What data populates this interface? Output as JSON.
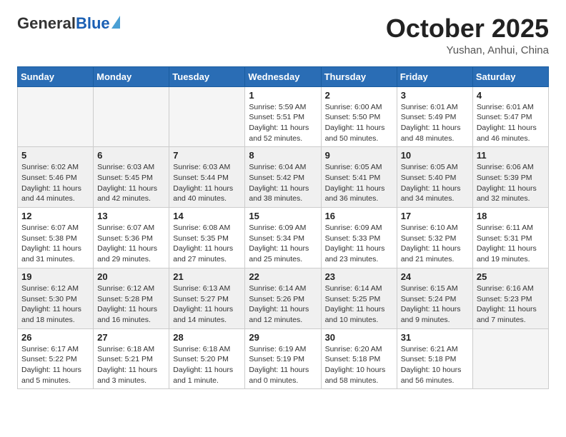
{
  "header": {
    "logo_general": "General",
    "logo_blue": "Blue",
    "month_title": "October 2025",
    "location": "Yushan, Anhui, China"
  },
  "weekdays": [
    "Sunday",
    "Monday",
    "Tuesday",
    "Wednesday",
    "Thursday",
    "Friday",
    "Saturday"
  ],
  "weeks": [
    [
      {
        "day": "",
        "info": ""
      },
      {
        "day": "",
        "info": ""
      },
      {
        "day": "",
        "info": ""
      },
      {
        "day": "1",
        "info": "Sunrise: 5:59 AM\nSunset: 5:51 PM\nDaylight: 11 hours\nand 52 minutes."
      },
      {
        "day": "2",
        "info": "Sunrise: 6:00 AM\nSunset: 5:50 PM\nDaylight: 11 hours\nand 50 minutes."
      },
      {
        "day": "3",
        "info": "Sunrise: 6:01 AM\nSunset: 5:49 PM\nDaylight: 11 hours\nand 48 minutes."
      },
      {
        "day": "4",
        "info": "Sunrise: 6:01 AM\nSunset: 5:47 PM\nDaylight: 11 hours\nand 46 minutes."
      }
    ],
    [
      {
        "day": "5",
        "info": "Sunrise: 6:02 AM\nSunset: 5:46 PM\nDaylight: 11 hours\nand 44 minutes."
      },
      {
        "day": "6",
        "info": "Sunrise: 6:03 AM\nSunset: 5:45 PM\nDaylight: 11 hours\nand 42 minutes."
      },
      {
        "day": "7",
        "info": "Sunrise: 6:03 AM\nSunset: 5:44 PM\nDaylight: 11 hours\nand 40 minutes."
      },
      {
        "day": "8",
        "info": "Sunrise: 6:04 AM\nSunset: 5:42 PM\nDaylight: 11 hours\nand 38 minutes."
      },
      {
        "day": "9",
        "info": "Sunrise: 6:05 AM\nSunset: 5:41 PM\nDaylight: 11 hours\nand 36 minutes."
      },
      {
        "day": "10",
        "info": "Sunrise: 6:05 AM\nSunset: 5:40 PM\nDaylight: 11 hours\nand 34 minutes."
      },
      {
        "day": "11",
        "info": "Sunrise: 6:06 AM\nSunset: 5:39 PM\nDaylight: 11 hours\nand 32 minutes."
      }
    ],
    [
      {
        "day": "12",
        "info": "Sunrise: 6:07 AM\nSunset: 5:38 PM\nDaylight: 11 hours\nand 31 minutes."
      },
      {
        "day": "13",
        "info": "Sunrise: 6:07 AM\nSunset: 5:36 PM\nDaylight: 11 hours\nand 29 minutes."
      },
      {
        "day": "14",
        "info": "Sunrise: 6:08 AM\nSunset: 5:35 PM\nDaylight: 11 hours\nand 27 minutes."
      },
      {
        "day": "15",
        "info": "Sunrise: 6:09 AM\nSunset: 5:34 PM\nDaylight: 11 hours\nand 25 minutes."
      },
      {
        "day": "16",
        "info": "Sunrise: 6:09 AM\nSunset: 5:33 PM\nDaylight: 11 hours\nand 23 minutes."
      },
      {
        "day": "17",
        "info": "Sunrise: 6:10 AM\nSunset: 5:32 PM\nDaylight: 11 hours\nand 21 minutes."
      },
      {
        "day": "18",
        "info": "Sunrise: 6:11 AM\nSunset: 5:31 PM\nDaylight: 11 hours\nand 19 minutes."
      }
    ],
    [
      {
        "day": "19",
        "info": "Sunrise: 6:12 AM\nSunset: 5:30 PM\nDaylight: 11 hours\nand 18 minutes."
      },
      {
        "day": "20",
        "info": "Sunrise: 6:12 AM\nSunset: 5:28 PM\nDaylight: 11 hours\nand 16 minutes."
      },
      {
        "day": "21",
        "info": "Sunrise: 6:13 AM\nSunset: 5:27 PM\nDaylight: 11 hours\nand 14 minutes."
      },
      {
        "day": "22",
        "info": "Sunrise: 6:14 AM\nSunset: 5:26 PM\nDaylight: 11 hours\nand 12 minutes."
      },
      {
        "day": "23",
        "info": "Sunrise: 6:14 AM\nSunset: 5:25 PM\nDaylight: 11 hours\nand 10 minutes."
      },
      {
        "day": "24",
        "info": "Sunrise: 6:15 AM\nSunset: 5:24 PM\nDaylight: 11 hours\nand 9 minutes."
      },
      {
        "day": "25",
        "info": "Sunrise: 6:16 AM\nSunset: 5:23 PM\nDaylight: 11 hours\nand 7 minutes."
      }
    ],
    [
      {
        "day": "26",
        "info": "Sunrise: 6:17 AM\nSunset: 5:22 PM\nDaylight: 11 hours\nand 5 minutes."
      },
      {
        "day": "27",
        "info": "Sunrise: 6:18 AM\nSunset: 5:21 PM\nDaylight: 11 hours\nand 3 minutes."
      },
      {
        "day": "28",
        "info": "Sunrise: 6:18 AM\nSunset: 5:20 PM\nDaylight: 11 hours\nand 1 minute."
      },
      {
        "day": "29",
        "info": "Sunrise: 6:19 AM\nSunset: 5:19 PM\nDaylight: 11 hours\nand 0 minutes."
      },
      {
        "day": "30",
        "info": "Sunrise: 6:20 AM\nSunset: 5:18 PM\nDaylight: 10 hours\nand 58 minutes."
      },
      {
        "day": "31",
        "info": "Sunrise: 6:21 AM\nSunset: 5:18 PM\nDaylight: 10 hours\nand 56 minutes."
      },
      {
        "day": "",
        "info": ""
      }
    ]
  ]
}
